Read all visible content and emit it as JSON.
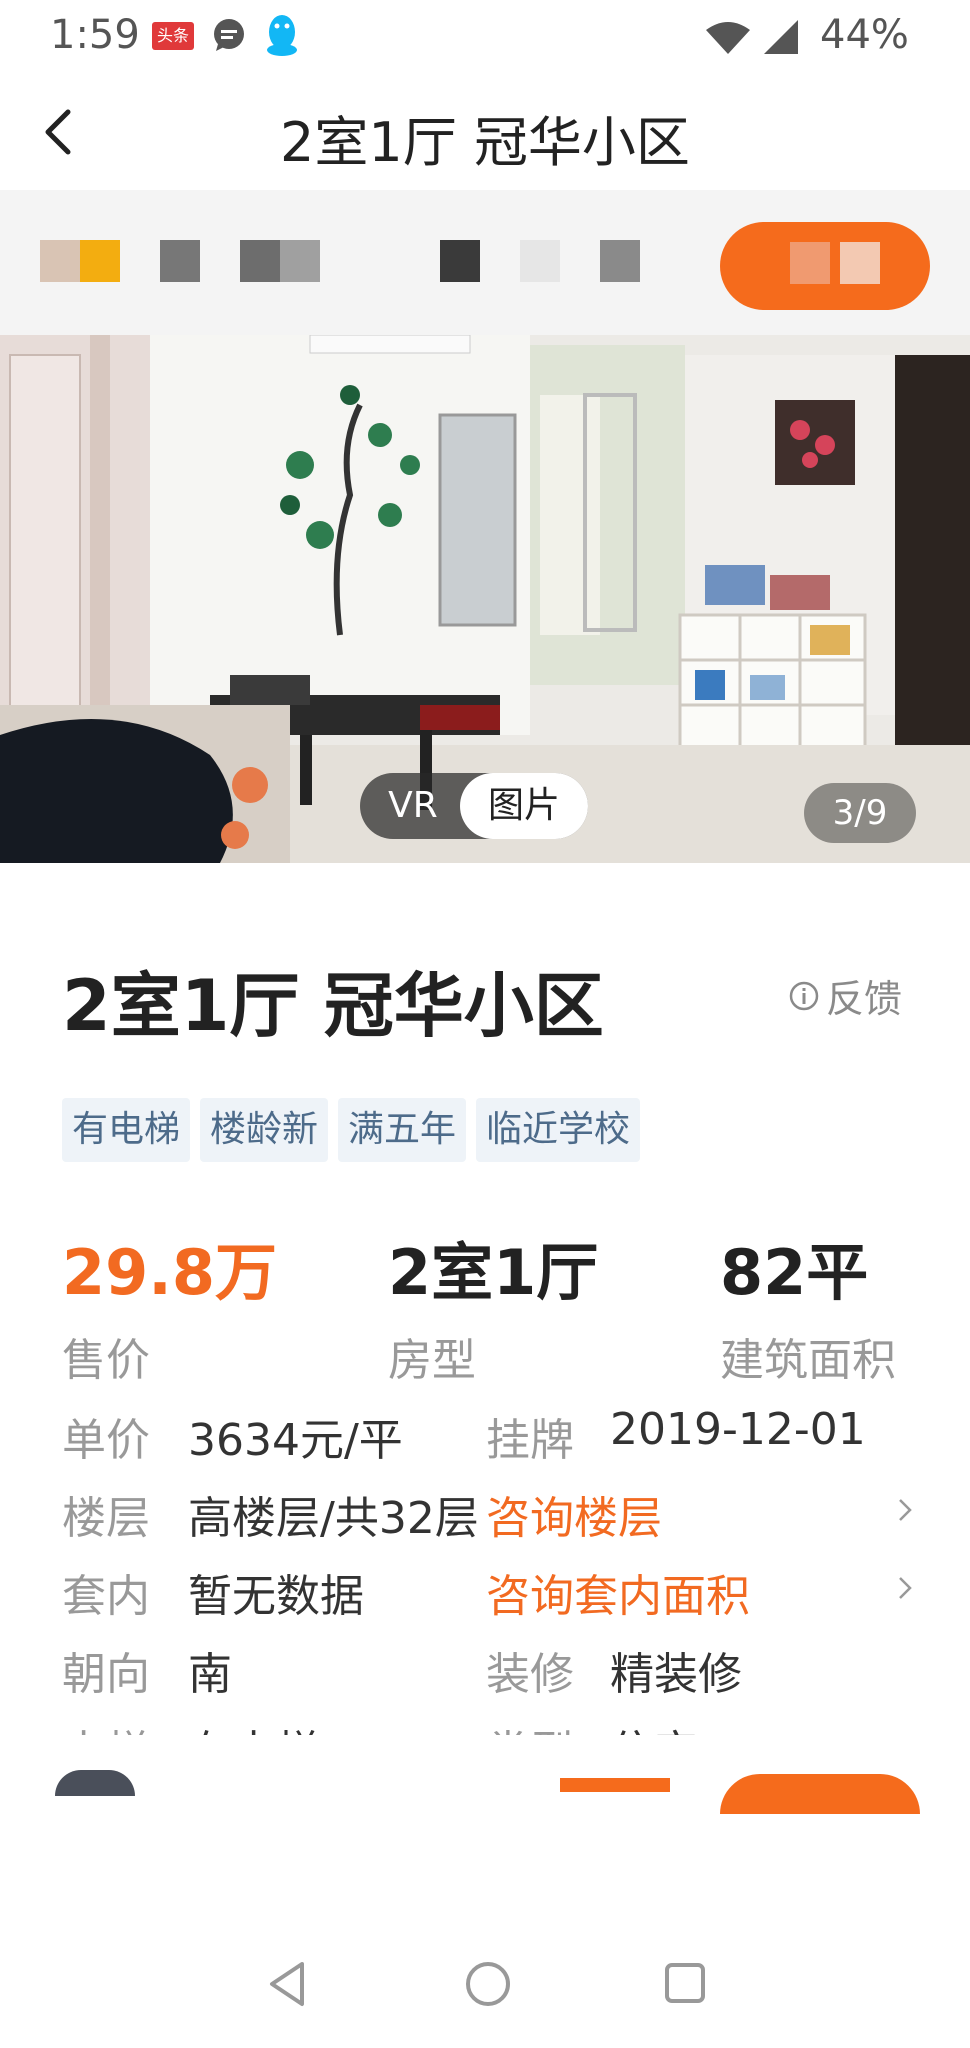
{
  "status_bar": {
    "time": "1:59",
    "news_badge": "头条",
    "battery": "44%",
    "icons": [
      "news-icon",
      "message-icon",
      "qq-icon",
      "wifi-icon",
      "signal-icon"
    ]
  },
  "header": {
    "title": "2室1厅 冠华小区",
    "back_icon": "chevron-left-icon"
  },
  "gallery": {
    "vr_label": "VR",
    "photo_label": "图片",
    "counter": "3/9"
  },
  "listing": {
    "title": "2室1厅 冠华小区",
    "feedback": "反馈",
    "tags": [
      "有电梯",
      "楼龄新",
      "满五年",
      "临近学校"
    ],
    "stats": [
      {
        "value": "29.8万",
        "label": "售价"
      },
      {
        "value": "2室1厅",
        "label": "房型"
      },
      {
        "value": "82平",
        "label": "建筑面积"
      }
    ],
    "details": {
      "unit_price_label": "单价",
      "unit_price": "3634元/平",
      "listed_label": "挂牌",
      "listed": "2019-12-01",
      "floor_label": "楼层",
      "floor": "高楼层/共32层",
      "floor_link": "咨询楼层",
      "inner_label": "套内",
      "inner": "暂无数据",
      "inner_link": "咨询套内面积",
      "orientation_label": "朝向",
      "orientation": "南",
      "decoration_label": "装修",
      "decoration": "精装修",
      "elevator_label": "电梯",
      "elevator": "有电梯",
      "type_label": "类型",
      "type": "住宅"
    }
  },
  "colors": {
    "accent": "#f26a21",
    "tag_bg": "#eef3f8",
    "tag_text": "#4d6b8a",
    "muted": "#999999"
  }
}
